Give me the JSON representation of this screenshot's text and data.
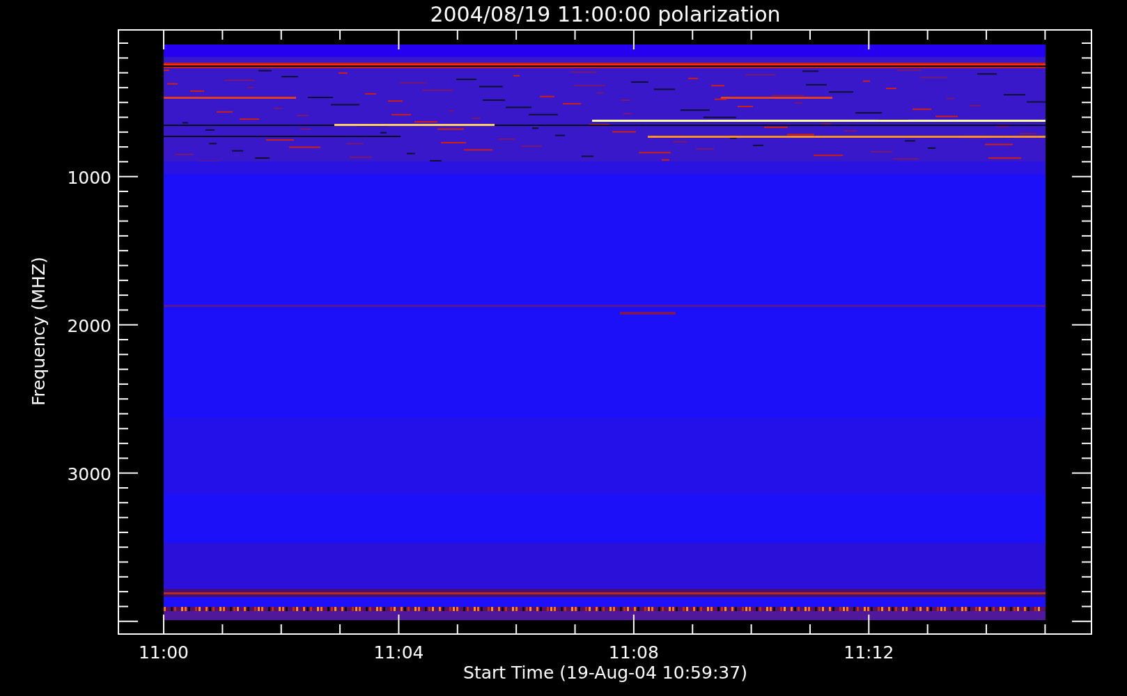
{
  "plot": {
    "title": "2004/08/19 11:00:00 polarization",
    "xlabel": "Start Time (19-Aug-04 10:59:37)",
    "ylabel": "Frequency (MHZ)",
    "xticks": [
      "11:00",
      "11:04",
      "11:08",
      "11:12"
    ],
    "yticks": [
      "1000",
      "2000",
      "3000"
    ]
  }
}
